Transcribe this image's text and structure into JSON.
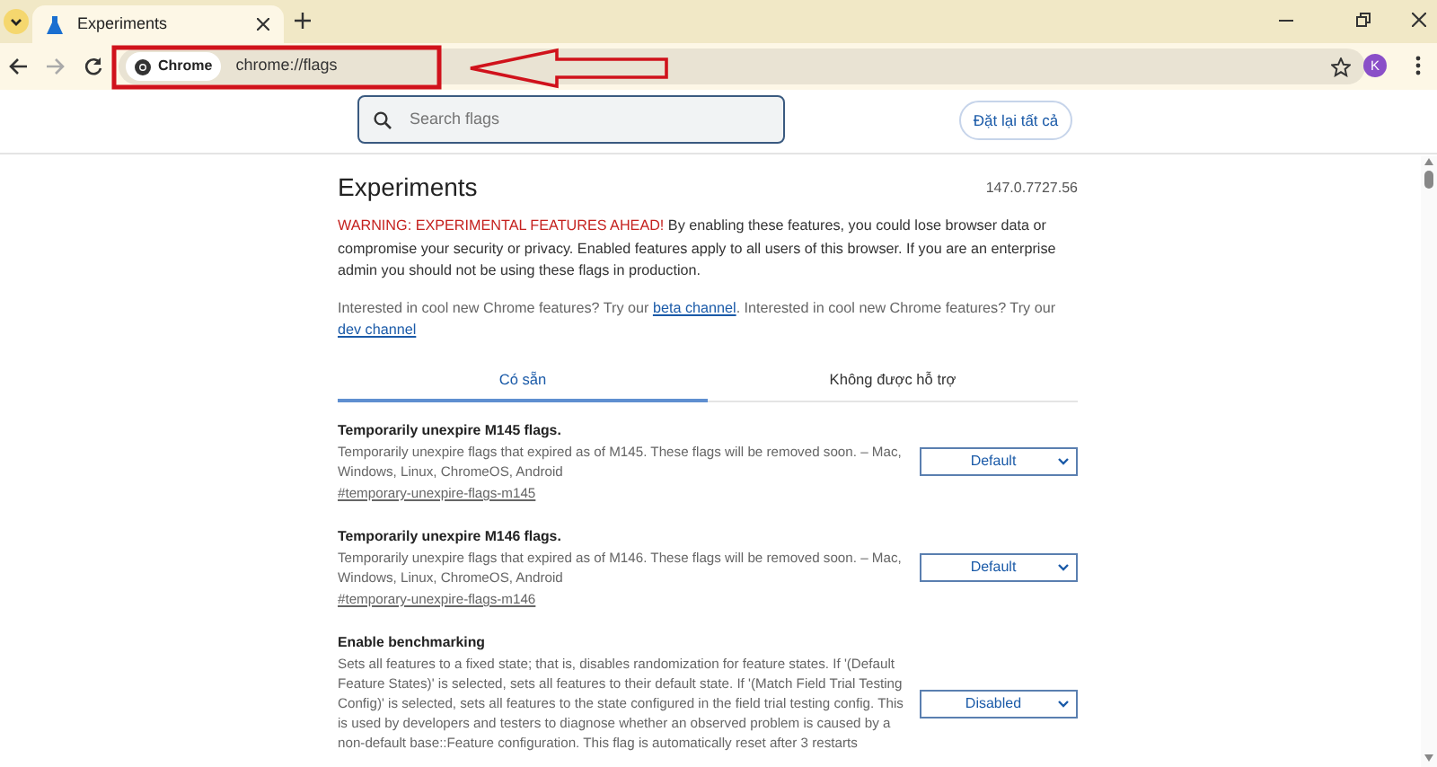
{
  "browser": {
    "tab_title": "Experiments",
    "chip": "Chrome",
    "url": "chrome://flags",
    "profile": "K"
  },
  "search": {
    "placeholder": "Search flags"
  },
  "reset_button": "Đặt lại tất cả",
  "title": "Experiments",
  "version": "147.0.7727.56",
  "warning": {
    "lead": "WARNING: EXPERIMENTAL FEATURES AHEAD!",
    "body": "By enabling these features, you could lose browser data or compromise your security or privacy. Enabled features apply to all users of this browser. If you are an enterprise admin you should not be using these flags in production."
  },
  "interest": [
    {
      "kind": "text",
      "text": "Interested in cool new Chrome features? Try our"
    },
    {
      "kind": "link",
      "text": "beta channel"
    },
    {
      "kind": "text",
      "text": ". Interested in cool new Chrome features? Try our"
    },
    {
      "kind": "link",
      "text": "dev channel"
    }
  ],
  "tabs": [
    {
      "label": "Có sẵn",
      "selected": true
    },
    {
      "label": "Không được hỗ trợ",
      "selected": false
    }
  ],
  "flags": [
    {
      "name": "Temporarily unexpire M145 flags.",
      "description": "Temporarily unexpire flags that expired as of M145. These flags will be removed soon. – Mac, Windows, Linux, ChromeOS, Android",
      "anchor": "#temporary-unexpire-flags-m145",
      "value": "Default"
    },
    {
      "name": "Temporarily unexpire M146 flags.",
      "description": "Temporarily unexpire flags that expired as of M146. These flags will be removed soon. – Mac, Windows, Linux, ChromeOS, Android",
      "anchor": "#temporary-unexpire-flags-m146",
      "value": "Default"
    },
    {
      "name": "Enable benchmarking",
      "description": "Sets all features to a fixed state; that is, disables randomization for feature states. If '(Default Feature States)' is selected, sets all features to their default state. If '(Match Field Trial Testing Config)' is selected, sets all features to the state configured in the field trial testing config. This is used by developers and testers to diagnose whether an observed problem is caused by a non-default base::Feature configuration. This flag is automatically reset after 3 restarts",
      "value": "Disabled"
    }
  ]
}
